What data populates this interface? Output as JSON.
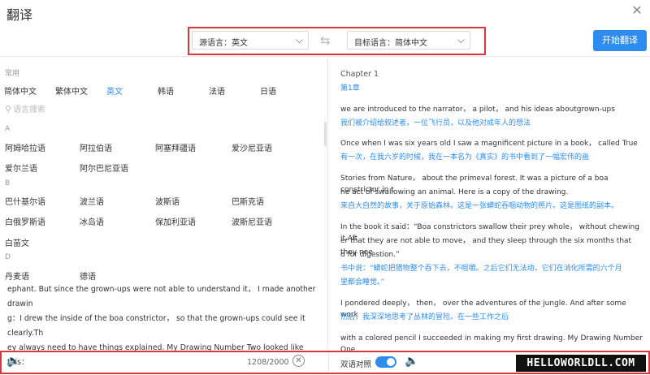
{
  "window": {
    "title": "翻译",
    "close_icon": "close-icon"
  },
  "toolbar": {
    "source_lang": "源语言：英文",
    "target_lang": "目标语言：简体中文",
    "start_button": "开始翻译"
  },
  "language_panel": {
    "common_label": "常用",
    "common": [
      {
        "label": "简体中文",
        "active": false
      },
      {
        "label": "繁体中文",
        "active": false
      },
      {
        "label": "英文",
        "active": true
      },
      {
        "label": "韩语",
        "active": false
      },
      {
        "label": "法语",
        "active": false
      },
      {
        "label": "日语",
        "active": false
      }
    ],
    "search_placeholder": "语言搜索",
    "groups": [
      {
        "letter": "A",
        "items": [
          "阿姆哈拉语",
          "阿拉伯语",
          "阿塞拜疆语",
          "爱沙尼亚语",
          "爱尔兰语",
          "阿尔巴尼亚语"
        ]
      },
      {
        "letter": "B",
        "items": [
          "巴什基尔语",
          "波兰语",
          "波斯语",
          "巴斯克语",
          "白俄罗斯语",
          "冰岛语",
          "保加利亚语",
          "波斯尼亚语",
          "白苗文"
        ]
      },
      {
        "letter": "D",
        "items": [
          "丹麦语",
          "德语"
        ]
      }
    ]
  },
  "source_text": [
    "ephant. But since the grown-ups were not able to understand it， I made another drawin",
    "g：I drew the inside of the boa constrictor， so that the grown-ups could see it clearly.Th",
    "ey always need to have things explained. My Drawing Number Two looked like this："
  ],
  "translation": {
    "lines": [
      {
        "text": "Chapter 1",
        "kind": "title"
      },
      {
        "text": "第1章",
        "kind": "tr"
      },
      {
        "text": "we are introduced to the narrator， a pilot， and his ideas aboutgrown-ups",
        "kind": "src"
      },
      {
        "text": "我们被介绍给叙述者，一位飞行员，以及他对成年人的想法",
        "kind": "tr"
      },
      {
        "text": "Once when I was six years old I saw a magnificent picture in a book， called True",
        "kind": "src"
      },
      {
        "text": "有一次，在我六岁的时候，我在一本名为《真实》的书中看到了一幅宏伟的画",
        "kind": "tr"
      },
      {
        "text": "Stories from Nature， about the primeval forest. It was a picture of a boa constrictor in t",
        "kind": "src"
      },
      {
        "text": "he act of swallowing an animal. Here is a copy of the drawing.",
        "kind": "src"
      },
      {
        "text": "来自大自然的故事，关于原始森林。这是一张蟒蛇吞咽动物的照片。这是图纸的副本。",
        "kind": "tr"
      },
      {
        "text": "In the book it said：“Boa constrictors swallow their prey whole， without chewing it.Aft",
        "kind": "src"
      },
      {
        "text": "er that they are not able to move， and they sleep through the six months that they nee",
        "kind": "src"
      },
      {
        "text": "d for digestion.”",
        "kind": "src"
      },
      {
        "text": "书中说：“蟒蛇把猎物整个吞下去，不咀嚼。之后它们无法动，它们在消化所需的六个月",
        "kind": "tr"
      },
      {
        "text": "里都会睡觉。”",
        "kind": "tr"
      },
      {
        "text": "I pondered deeply， then， over the adventures of the jungle. And after some work",
        "kind": "src"
      },
      {
        "text": "然后，我深深地思考了丛林的冒险。在一些工作之后",
        "kind": "tr"
      },
      {
        "text": "with a colored pencil I succeeded in making my first drawing. My Drawing Number One.",
        "kind": "src"
      }
    ]
  },
  "bottom_bar": {
    "char_count": "1208/2000",
    "bilingual_label": "双语对照",
    "bilingual_on": true,
    "watermark": "HELLOWORLDLL.COM"
  },
  "colors": {
    "accent": "#2d8cf0",
    "highlight_border": "#d9363e"
  }
}
